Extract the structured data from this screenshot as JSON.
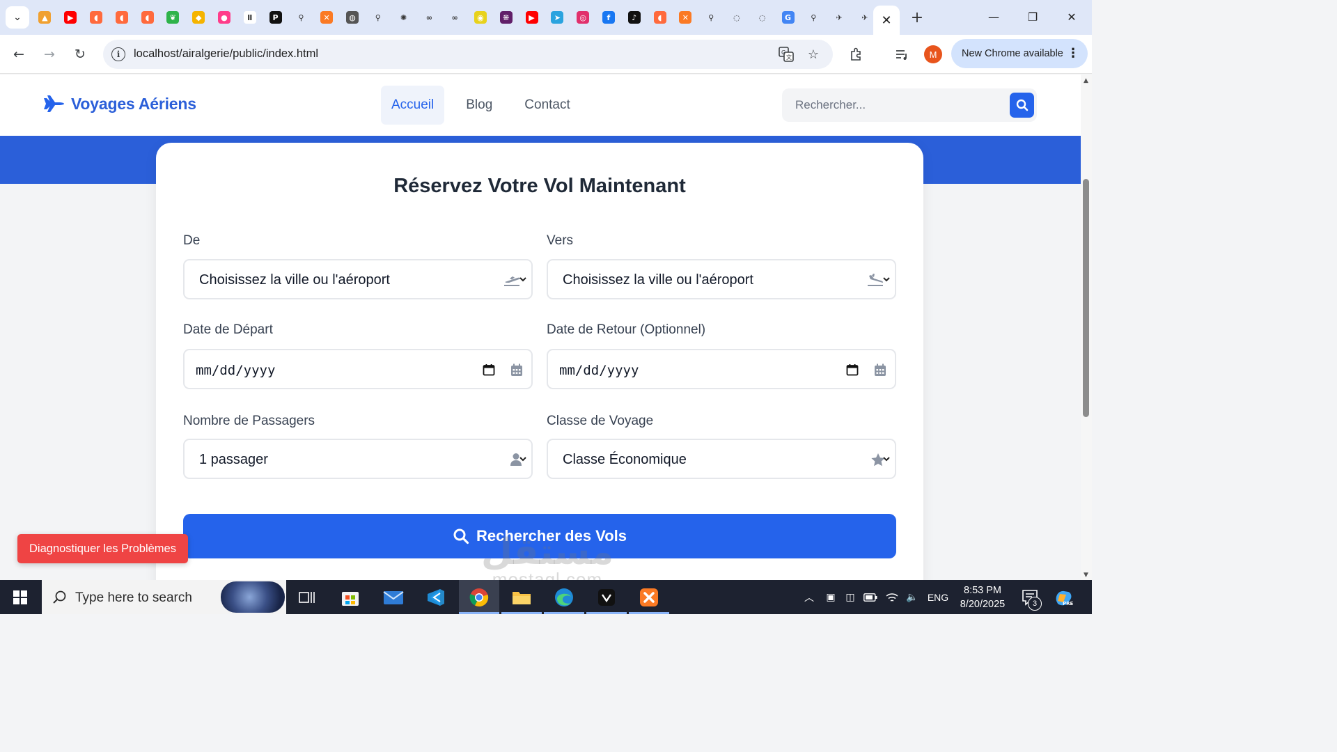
{
  "browser": {
    "url": "localhost/airalgerie/public/index.html",
    "update_label": "New Chrome available",
    "profile_initial": "M",
    "pinned_tabs": [
      {
        "icon": "pma-icon",
        "color": "#f0a030",
        "glyph": "▲"
      },
      {
        "icon": "youtube-icon",
        "color": "#ff0000",
        "glyph": "▶"
      },
      {
        "icon": "bookmark-app-icon",
        "color": "#ff6a3d",
        "glyph": "◖"
      },
      {
        "icon": "bookmark-app-icon",
        "color": "#ff6a3d",
        "glyph": "◖"
      },
      {
        "icon": "bookmark-app-icon",
        "color": "#ff6a3d",
        "glyph": "◖"
      },
      {
        "icon": "leaf-app-icon",
        "color": "#2eb34a",
        "glyph": "❦"
      },
      {
        "icon": "graduation-icon",
        "color": "#f5b400",
        "glyph": "◆"
      },
      {
        "icon": "drop-app-icon",
        "color": "#ff3d8b",
        "glyph": "●"
      },
      {
        "icon": "pause-icon",
        "color": "#ffffff",
        "glyph": "Ⅱ"
      },
      {
        "icon": "p-app-icon",
        "color": "#111111",
        "glyph": "P"
      },
      {
        "icon": "search-tab-icon",
        "color": "#dfe7f8",
        "glyph": "⚲"
      },
      {
        "icon": "xampp-icon",
        "color": "#fb7a24",
        "glyph": "✕"
      },
      {
        "icon": "globe-icon",
        "color": "#555555",
        "glyph": "◍"
      },
      {
        "icon": "search-tab-icon",
        "color": "#dfe7f8",
        "glyph": "⚲"
      },
      {
        "icon": "openai-icon",
        "color": "#dfe7f8",
        "glyph": "✺"
      },
      {
        "icon": "infinity-icon",
        "color": "#dfe7f8",
        "glyph": "∞"
      },
      {
        "icon": "infinity-icon",
        "color": "#dfe7f8",
        "glyph": "∞"
      },
      {
        "icon": "clock-app-icon",
        "color": "#e8d21c",
        "glyph": "◉"
      },
      {
        "icon": "slack-icon",
        "color": "#611f69",
        "glyph": "⁜"
      },
      {
        "icon": "youtube-icon",
        "color": "#ff0000",
        "glyph": "▶"
      },
      {
        "icon": "telegram-icon",
        "color": "#2aa3df",
        "glyph": "➤"
      },
      {
        "icon": "instagram-icon",
        "color": "#e1306c",
        "glyph": "◎"
      },
      {
        "icon": "facebook-icon",
        "color": "#1877f2",
        "glyph": "f"
      },
      {
        "icon": "tiktok-icon",
        "color": "#111111",
        "glyph": "♪"
      },
      {
        "icon": "bookmark-app-icon",
        "color": "#ff6a3d",
        "glyph": "◖"
      },
      {
        "icon": "xampp-icon",
        "color": "#fb7a24",
        "glyph": "✕"
      },
      {
        "icon": "search-tab-icon",
        "color": "#dfe7f8",
        "glyph": "⚲"
      },
      {
        "icon": "edge-icon",
        "color": "#dfe7f8",
        "glyph": "◌"
      },
      {
        "icon": "edge-icon",
        "color": "#dfe7f8",
        "glyph": "◌"
      },
      {
        "icon": "google-notify-icon",
        "color": "#4285f4",
        "glyph": "G"
      },
      {
        "icon": "search-tab-icon",
        "color": "#dfe7f8",
        "glyph": "⚲"
      },
      {
        "icon": "bird-app-icon",
        "color": "#dfe7f8",
        "glyph": "✈"
      },
      {
        "icon": "bird-app-icon",
        "color": "#dfe7f8",
        "glyph": "✈"
      }
    ]
  },
  "site": {
    "brand": "Voyages Aériens",
    "nav": [
      {
        "label": "Accueil",
        "active": true
      },
      {
        "label": "Blog",
        "active": false
      },
      {
        "label": "Contact",
        "active": false
      }
    ],
    "search_placeholder": "Rechercher...",
    "colors": {
      "primary": "#2563eb",
      "danger": "#ef4444"
    }
  },
  "booking": {
    "title": "Réservez Votre Vol Maintenant",
    "from_label": "De",
    "from_value": "Choisissez la ville ou l'aéroport",
    "to_label": "Vers",
    "to_value": "Choisissez la ville ou l'aéroport",
    "depart_label": "Date de Départ",
    "depart_value": "mm/dd/yyyy",
    "return_label": "Date de Retour (Optionnel)",
    "return_value": "mm/dd/yyyy",
    "passengers_label": "Nombre de Passagers",
    "passengers_value": "1 passager",
    "class_label": "Classe de Voyage",
    "class_value": "Classe Économique",
    "submit_label": "Rechercher des Vols"
  },
  "diagnose_label": "Diagnostiquer les Problèmes",
  "watermark": {
    "arabic": "مستقل",
    "latin": "mostaql.com"
  },
  "taskbar": {
    "search_placeholder": "Type here to search",
    "language": "ENG",
    "time": "8:53 PM",
    "date": "8/20/2025",
    "notification_count": "3"
  }
}
